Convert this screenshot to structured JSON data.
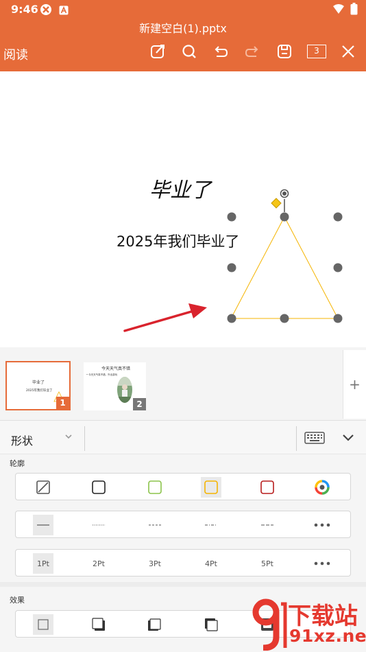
{
  "status_bar": {
    "time": "9:46",
    "left_icons": [
      "app-notification-icon",
      "a-notification-icon"
    ],
    "right_icons": [
      "wifi-icon",
      "battery-icon"
    ]
  },
  "header": {
    "title": "新建空白(1).pptx",
    "read_mode_label": "阅读",
    "toolbar_icons": [
      "edit-icon",
      "search-icon",
      "undo-icon",
      "redo-icon",
      "save-icon",
      "page-count",
      "close-icon"
    ],
    "page_count": "3",
    "background_color": "#E66B39"
  },
  "slide": {
    "title": "毕业了",
    "subtitle": "2025年我们毕业了",
    "selected_shape": "triangle",
    "outline_color": "#F5B400",
    "arrow_color": "#D9232D"
  },
  "thumbnails": {
    "items": [
      {
        "number": "1",
        "title": "毕业了",
        "subtitle": "2025年我们毕业了",
        "selected": true
      },
      {
        "number": "2",
        "title": "今天天气真不错",
        "bullet": "• 今天天气真不错，外出游玩",
        "selected": false
      }
    ],
    "add_label": "+"
  },
  "format_panel": {
    "category": "形状",
    "sections": {
      "outline": {
        "label": "轮廓",
        "colors": [
          {
            "name": "none",
            "color": "#555555",
            "selected": false
          },
          {
            "name": "black",
            "color": "#222222",
            "selected": false
          },
          {
            "name": "green",
            "color": "#8BC34A",
            "selected": false
          },
          {
            "name": "yellow",
            "color": "#F5B400",
            "selected": true
          },
          {
            "name": "red",
            "color": "#B71C1C",
            "selected": false
          },
          {
            "name": "more-colors",
            "color": "#4CAF50",
            "selected": false
          }
        ],
        "line_styles": [
          "solid",
          "dotted",
          "dash",
          "dash-dot",
          "long-dash",
          "more"
        ],
        "weights": [
          "1Pt",
          "2Pt",
          "3Pt",
          "4Pt",
          "5Pt"
        ],
        "selected_weight": "1Pt"
      },
      "effects": {
        "label": "效果",
        "options": [
          "none",
          "shadow-bottom-right",
          "shadow-left",
          "shadow-top-left",
          "shadow-outer"
        ]
      }
    }
  },
  "watermark": {
    "cn": "下载站",
    "en": "91xz.net"
  }
}
